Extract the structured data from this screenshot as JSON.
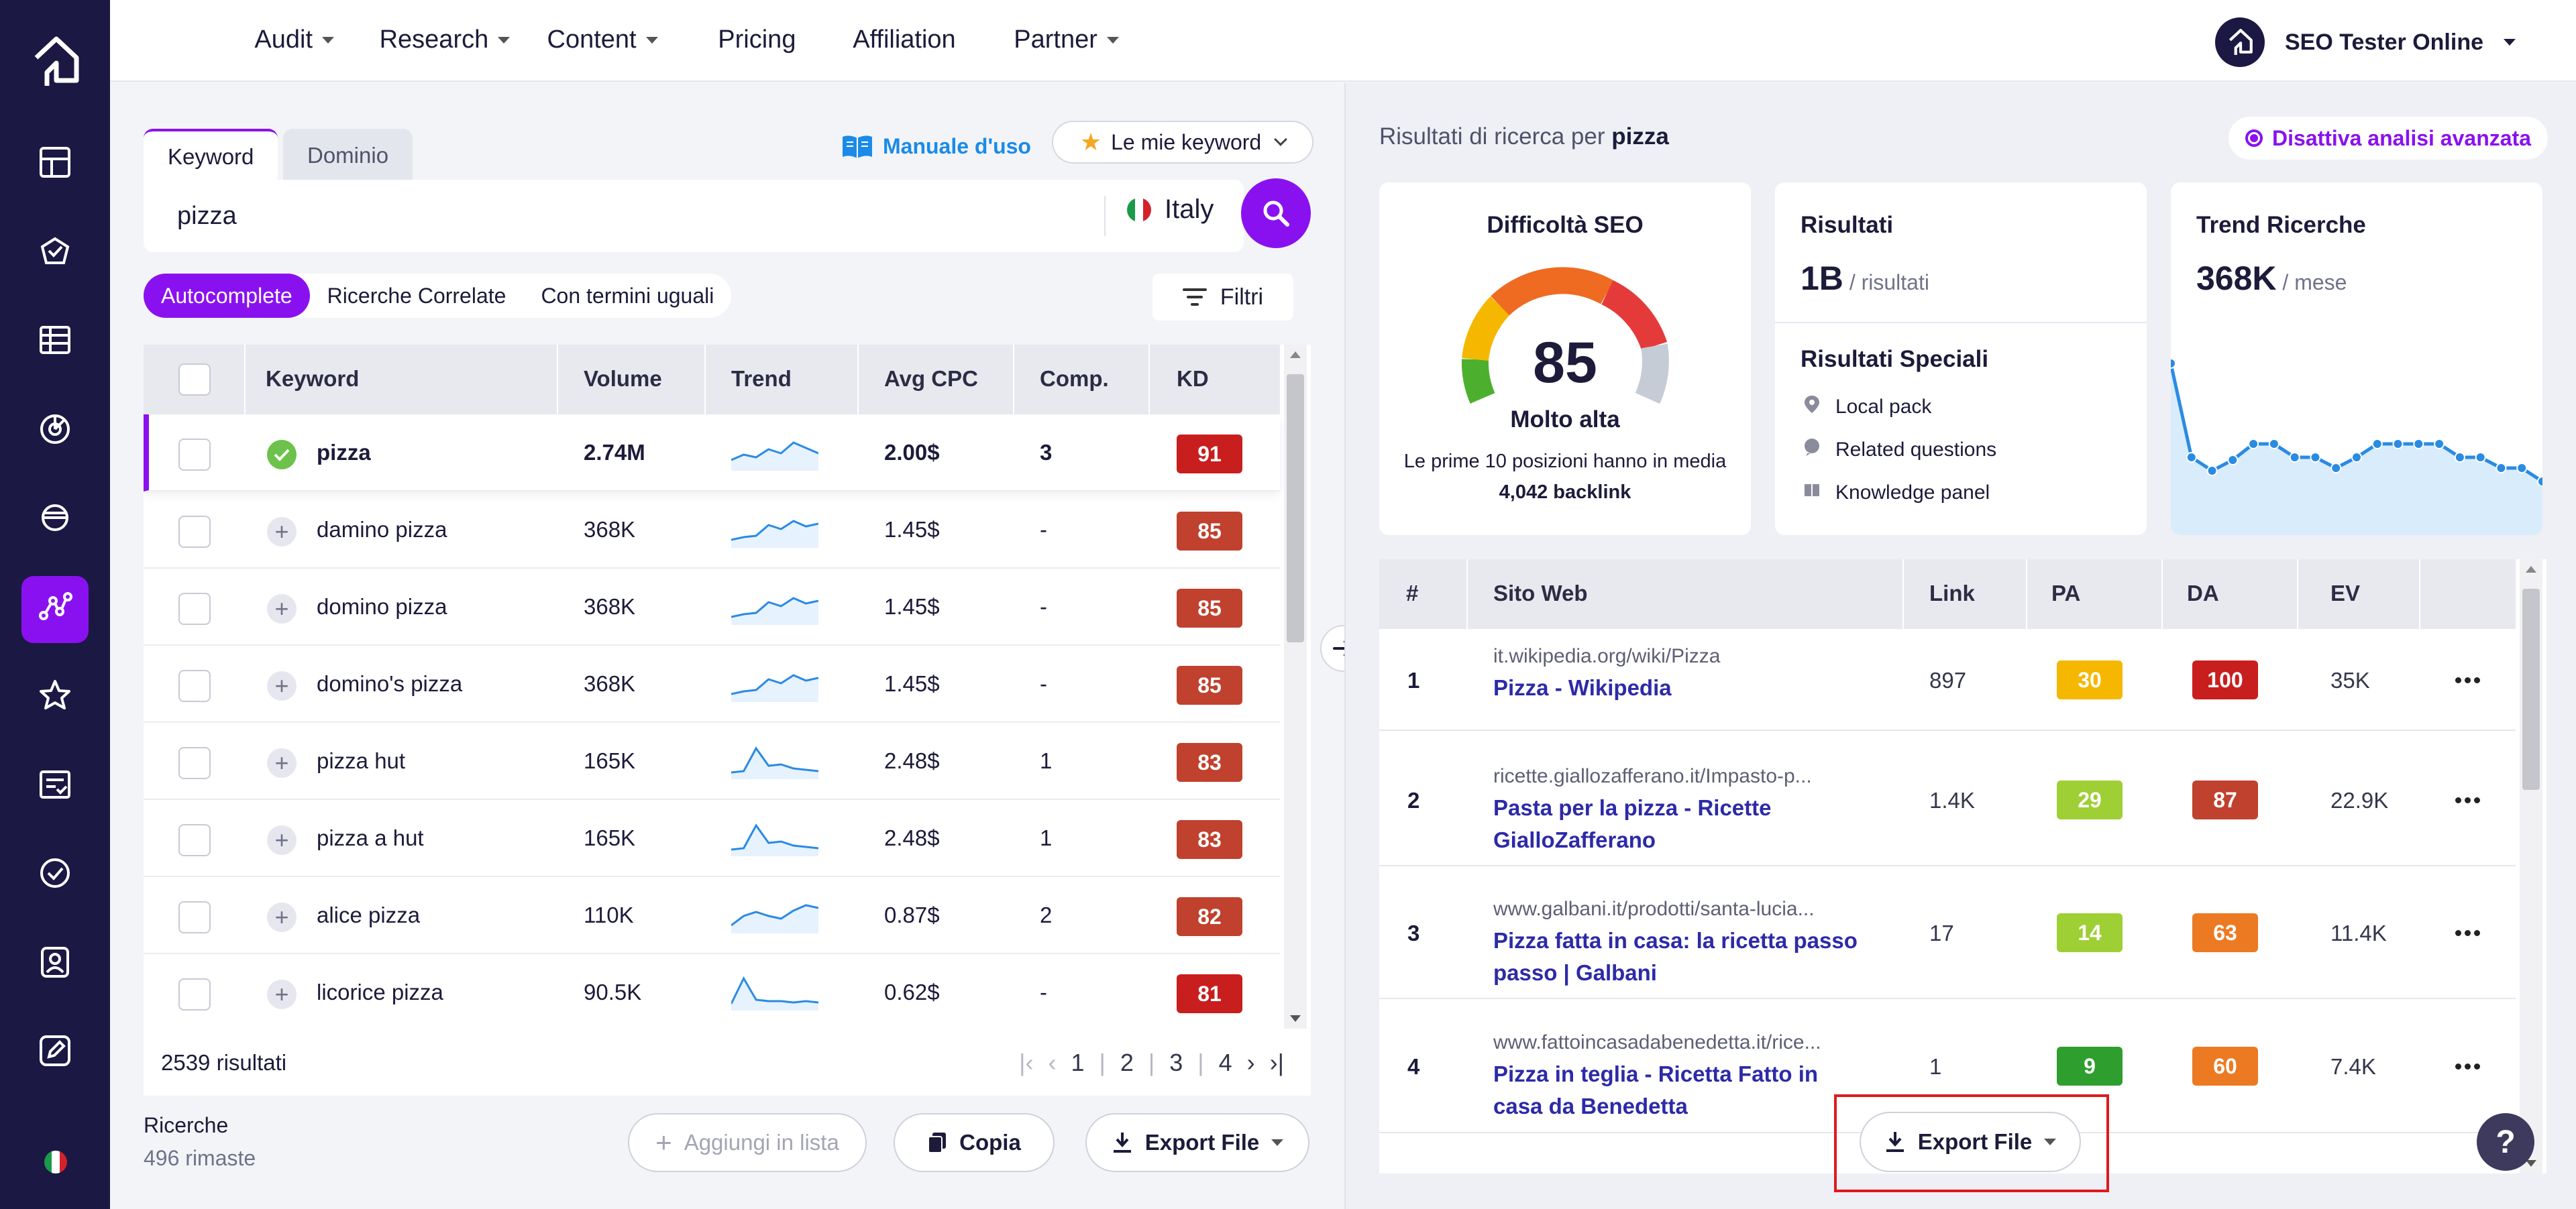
{
  "nav": {
    "items": [
      {
        "label": "Audit",
        "caret": true
      },
      {
        "label": "Research",
        "caret": true
      },
      {
        "label": "Content",
        "caret": true
      },
      {
        "label": "Pricing",
        "caret": false
      },
      {
        "label": "Affiliation",
        "caret": false
      },
      {
        "label": "Partner",
        "caret": true
      }
    ],
    "user": "SEO Tester Online"
  },
  "sidebar": {
    "items": [
      "dashboard-icon",
      "audit-icon",
      "table-icon",
      "radar-icon",
      "planet-icon",
      "keyword-graph-icon",
      "star-icon",
      "checklist-icon",
      "target-icon",
      "portrait-icon",
      "edit-icon"
    ],
    "active_index": 5
  },
  "search": {
    "tabs": [
      "Keyword",
      "Dominio"
    ],
    "active_tab": 0,
    "manual_label": "Manuale d'uso",
    "my_keywords_label": "Le mie keyword",
    "value": "pizza",
    "country": "Italy",
    "filters_label": "Filtri",
    "modes": [
      "Autocomplete",
      "Ricerche Correlate",
      "Con termini uguali"
    ],
    "active_mode": 0
  },
  "keyword_table": {
    "columns": [
      "Keyword",
      "Volume",
      "Trend",
      "Avg CPC",
      "Comp.",
      "KD"
    ],
    "rows": [
      {
        "keyword": "pizza",
        "volume": "2.74M",
        "cpc": "2.00$",
        "comp": "3",
        "kd": "91",
        "kd_color": "#c81e1e",
        "selected": true,
        "trend": [
          40,
          32,
          36,
          24,
          30,
          14,
          22,
          30
        ]
      },
      {
        "keyword": "damino pizza",
        "volume": "368K",
        "cpc": "1.45$",
        "comp": "-",
        "kd": "85",
        "kd_color": "#c0412e",
        "selected": false,
        "trend": [
          44,
          40,
          38,
          22,
          28,
          16,
          24,
          20
        ]
      },
      {
        "keyword": "domino pizza",
        "volume": "368K",
        "cpc": "1.45$",
        "comp": "-",
        "kd": "85",
        "kd_color": "#c0412e",
        "selected": false,
        "trend": [
          44,
          40,
          38,
          22,
          28,
          16,
          24,
          20
        ]
      },
      {
        "keyword": "domino's pizza",
        "volume": "368K",
        "cpc": "1.45$",
        "comp": "-",
        "kd": "85",
        "kd_color": "#c0412e",
        "selected": false,
        "trend": [
          44,
          40,
          38,
          22,
          28,
          16,
          24,
          20
        ]
      },
      {
        "keyword": "pizza hut",
        "volume": "165K",
        "cpc": "2.48$",
        "comp": "1",
        "kd": "83",
        "kd_color": "#c0412e",
        "selected": false,
        "trend": [
          46,
          44,
          10,
          36,
          34,
          40,
          42,
          44
        ]
      },
      {
        "keyword": "pizza a hut",
        "volume": "165K",
        "cpc": "2.48$",
        "comp": "1",
        "kd": "83",
        "kd_color": "#c0412e",
        "selected": false,
        "trend": [
          46,
          44,
          10,
          36,
          34,
          40,
          42,
          44
        ]
      },
      {
        "keyword": "alice pizza",
        "volume": "110K",
        "cpc": "0.87$",
        "comp": "2",
        "kd": "82",
        "kd_color": "#c0412e",
        "selected": false,
        "trend": [
          44,
          30,
          24,
          30,
          34,
          22,
          14,
          18
        ]
      },
      {
        "keyword": "licorice pizza",
        "volume": "90.5K",
        "cpc": "0.62$",
        "comp": "-",
        "kd": "81",
        "kd_color": "#c81e1e",
        "selected": false,
        "trend": [
          46,
          8,
          40,
          42,
          42,
          44,
          42,
          44
        ]
      }
    ],
    "results_count": "2539 risultati",
    "pages": [
      "1",
      "2",
      "3",
      "4"
    ]
  },
  "searches": {
    "label": "Ricerche",
    "remaining": "496 rimaste"
  },
  "actions": {
    "add_list": "Aggiungi in lista",
    "copy": "Copia",
    "export": "Export File"
  },
  "results": {
    "title_prefix": "Risultati di ricerca per",
    "query": "pizza",
    "advanced_label": "Disattiva analisi avanzata",
    "seo_difficulty": {
      "title": "Difficoltà SEO",
      "value": "85",
      "label": "Molto alta",
      "note": "Le prime 10 posizioni hanno in media",
      "backlinks": "4,042 backlink"
    },
    "results_card": {
      "title": "Risultati",
      "value": "1B",
      "unit": "/ risultati"
    },
    "special": {
      "title": "Risultati Speciali",
      "items": [
        {
          "label": "Local pack",
          "icon": "location-pin-icon"
        },
        {
          "label": "Related questions",
          "icon": "question-bubble-icon"
        },
        {
          "label": "Knowledge panel",
          "icon": "book-icon"
        }
      ]
    },
    "trend": {
      "title": "Trend Ricerche",
      "value": "368K",
      "unit": "/ mese",
      "series": [
        100,
        30,
        20,
        28,
        40,
        40,
        30,
        30,
        22,
        30,
        40,
        40,
        40,
        40,
        30,
        30,
        22,
        22,
        12
      ]
    }
  },
  "site_table": {
    "columns": [
      "#",
      "Sito Web",
      "Link",
      "PA",
      "DA",
      "EV"
    ],
    "rows": [
      {
        "rank": "1",
        "url": "it.wikipedia.org/wiki/Pizza",
        "title": "Pizza - Wikipedia",
        "link": "897",
        "pa": "30",
        "pa_color": "#f5b700",
        "da": "100",
        "da_color": "#c81e1e",
        "ev": "35K"
      },
      {
        "rank": "2",
        "url": "ricette.giallozafferano.it/Impasto-p...",
        "title": "Pasta per la pizza - Ricette GialloZafferano",
        "link": "1.4K",
        "pa": "29",
        "pa_color": "#9ecf34",
        "da": "87",
        "da_color": "#c0412e",
        "ev": "22.9K"
      },
      {
        "rank": "3",
        "url": "www.galbani.it/prodotti/santa-lucia...",
        "title": "Pizza fatta in casa: la ricetta passo passo | Galbani",
        "link": "17",
        "pa": "14",
        "pa_color": "#9ecf34",
        "da": "63",
        "da_color": "#ec7a22",
        "ev": "11.4K"
      },
      {
        "rank": "4",
        "url": "www.fattoincasadabenedetta.it/rice...",
        "title": "Pizza in teglia - Ricetta Fatto in casa da Benedetta",
        "link": "1",
        "pa": "9",
        "pa_color": "#2e9e2e",
        "da": "60",
        "da_color": "#ec7a22",
        "ev": "7.4K"
      }
    ]
  },
  "export_label": "Export File",
  "help_label": "?"
}
